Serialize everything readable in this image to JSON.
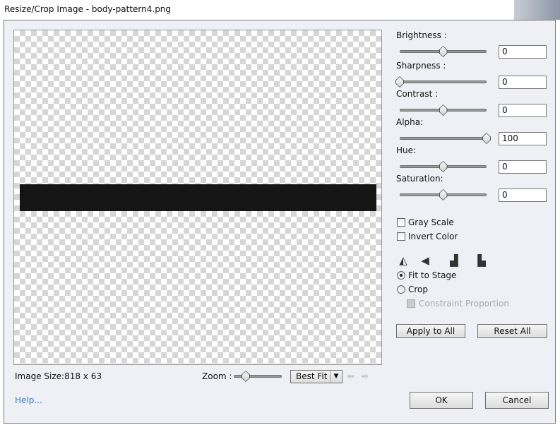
{
  "title": "Resize/Crop Image - body-pattern4.png",
  "adjustments": [
    {
      "label": "Brightness :",
      "value": "0",
      "fraction": 0.5
    },
    {
      "label": "Sharpness :",
      "value": "0",
      "fraction": 0
    },
    {
      "label": "Contrast :",
      "value": "0",
      "fraction": 0.5
    },
    {
      "label": "Alpha:",
      "value": "100",
      "fraction": 1
    },
    {
      "label": "Hue:",
      "value": "0",
      "fraction": 0.5
    },
    {
      "label": "Saturation:",
      "value": "0",
      "fraction": 0.5
    }
  ],
  "gray_scale": "Gray Scale",
  "invert_color": "Invert Color",
  "fit_to_stage": "Fit to Stage",
  "crop": "Crop",
  "constraint": "Constraint Proportion",
  "apply_all": "Apply to All",
  "reset_all": "Reset All",
  "image_size": "Image Size:818 x 63",
  "zoom_label": "Zoom :",
  "zoom_fraction": 0.25,
  "zoom_select": "Best Fit",
  "help": "Help...",
  "ok": "OK",
  "cancel": "Cancel"
}
